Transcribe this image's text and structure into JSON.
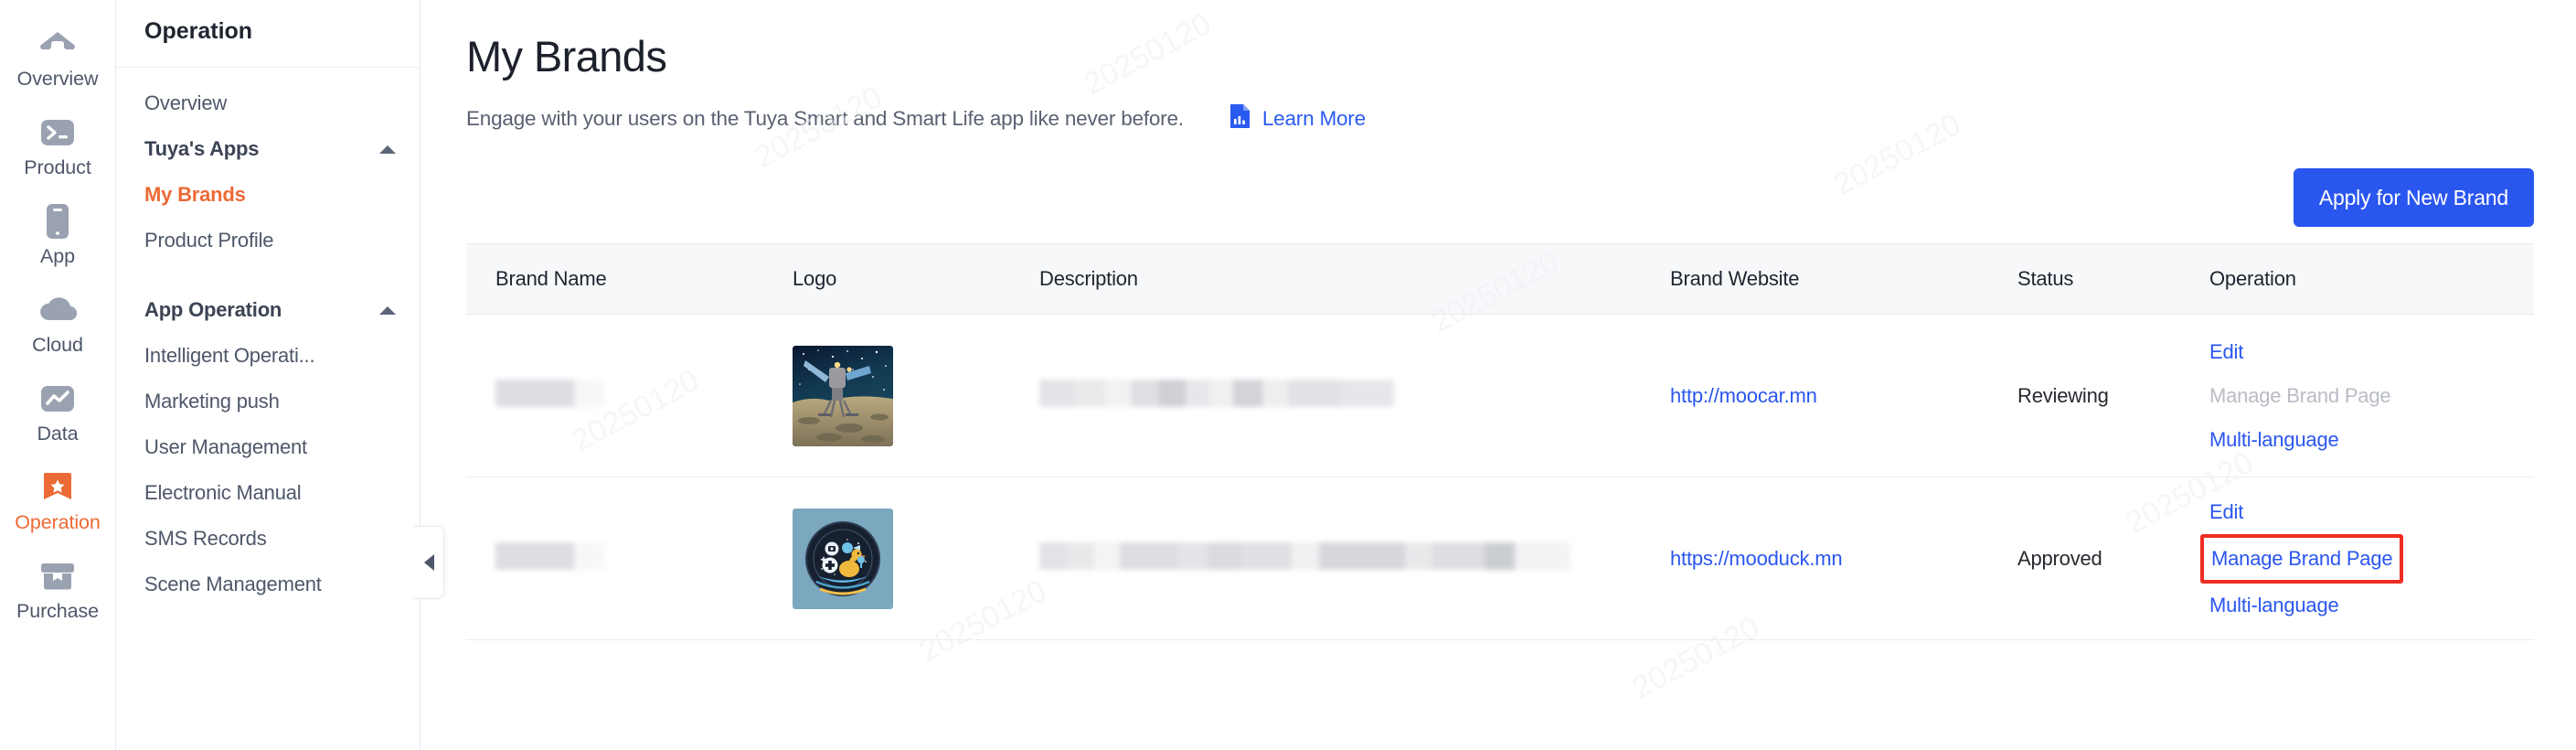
{
  "rail": {
    "items": [
      {
        "label": "Overview",
        "icon": "home-icon",
        "active": false
      },
      {
        "label": "Product",
        "icon": "terminal-icon",
        "active": false
      },
      {
        "label": "App",
        "icon": "phone-icon",
        "active": false
      },
      {
        "label": "Cloud",
        "icon": "cloud-icon",
        "active": false
      },
      {
        "label": "Data",
        "icon": "chart-line-icon",
        "active": false
      },
      {
        "label": "Operation",
        "icon": "bookmark-star-icon",
        "active": true
      },
      {
        "label": "Purchase",
        "icon": "box-icon",
        "active": false
      }
    ],
    "active_color": "#ec6a35",
    "inactive_color": "#4e5769"
  },
  "subnav": {
    "title": "Operation",
    "items": [
      {
        "label": "Overview",
        "type": "item",
        "active": false
      },
      {
        "label": "Tuya's Apps",
        "type": "group",
        "expanded": true
      },
      {
        "label": "My Brands",
        "type": "item",
        "active": true
      },
      {
        "label": "Product Profile",
        "type": "item",
        "active": false
      },
      {
        "label": "App Operation",
        "type": "group",
        "expanded": true
      },
      {
        "label": "Intelligent Operati...",
        "type": "item",
        "active": false
      },
      {
        "label": "Marketing push",
        "type": "item",
        "active": false
      },
      {
        "label": "User Management",
        "type": "item",
        "active": false
      },
      {
        "label": "Electronic Manual",
        "type": "item",
        "active": false
      },
      {
        "label": "SMS Records",
        "type": "item",
        "active": false
      },
      {
        "label": "Scene Management",
        "type": "item",
        "active": false
      }
    ],
    "collapse_handle_icon": "chevron-left-icon"
  },
  "main": {
    "page_title": "My Brands",
    "description": "Engage with your users on the Tuya Smart and Smart Life app like never before.",
    "learn_more": {
      "label": "Learn More",
      "icon": "document-chart-icon",
      "color": "#2a5bf0"
    },
    "apply_button": {
      "label": "Apply for New Brand",
      "color": "#2a56f0"
    }
  },
  "table": {
    "columns": [
      "Brand Name",
      "Logo",
      "Description",
      "Brand Website",
      "Status",
      "Operation"
    ],
    "rows": [
      {
        "brand_name": "",
        "brand_name_redacted": true,
        "logo": "lunar-lander-on-moon-surface-with-starry-sky",
        "description": "",
        "description_redacted": true,
        "website": "http://moocar.mn",
        "status": "Reviewing",
        "operations": [
          {
            "label": "Edit",
            "state": "enabled"
          },
          {
            "label": "Manage Brand Page",
            "state": "disabled"
          },
          {
            "label": "Multi-language",
            "state": "enabled"
          }
        ]
      },
      {
        "brand_name": "",
        "brand_name_redacted": true,
        "logo": "circular-duck-emblem-badge-on-blue-gray-background",
        "description": "",
        "description_redacted": true,
        "website": "https://mooduck.mn",
        "status": "Approved",
        "operations": [
          {
            "label": "Edit",
            "state": "enabled"
          },
          {
            "label": "Manage Brand Page",
            "state": "enabled",
            "highlighted": true
          },
          {
            "label": "Multi-language",
            "state": "enabled"
          }
        ]
      }
    ]
  },
  "highlight": {
    "color": "#ef2c20"
  }
}
